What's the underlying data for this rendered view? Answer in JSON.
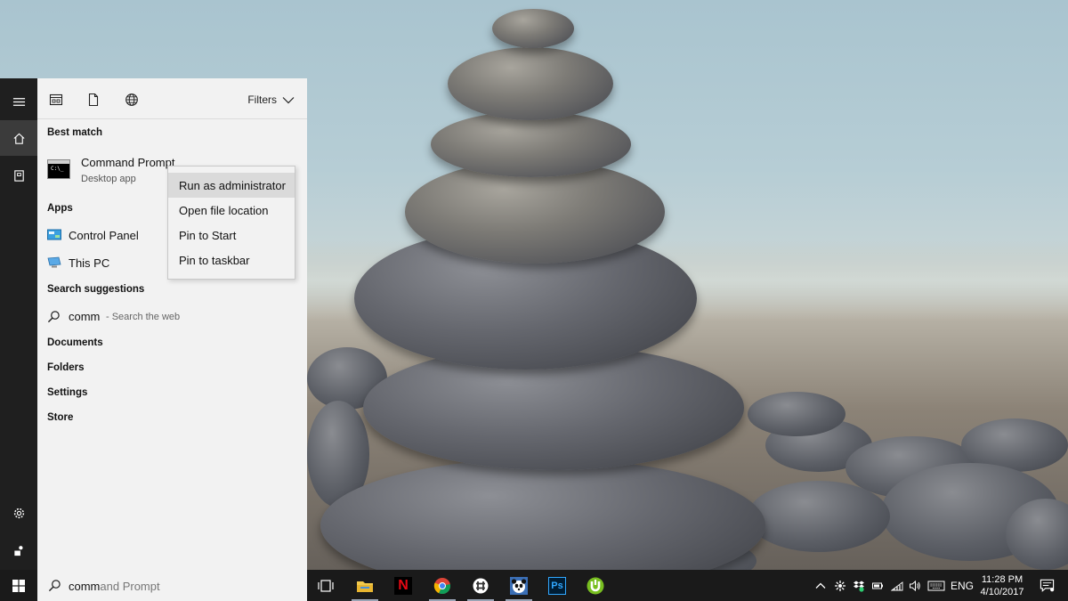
{
  "panel": {
    "filters_label": "Filters",
    "best_match": {
      "heading": "Best match",
      "title": "Command Prompt",
      "subtitle": "Desktop app"
    },
    "apps": {
      "heading": "Apps",
      "items": [
        {
          "label": "Control Panel",
          "icon": "control-panel-icon"
        },
        {
          "label": "This PC",
          "icon": "this-pc-icon"
        }
      ]
    },
    "suggestions": {
      "heading": "Search suggestions",
      "term": "comm",
      "hint": "- Search the web"
    },
    "categories": [
      "Documents",
      "Folders",
      "Settings",
      "Store"
    ]
  },
  "context_menu": {
    "items": [
      "Run as administrator",
      "Open file location",
      "Pin to Start",
      "Pin to taskbar"
    ],
    "highlighted_index": 0
  },
  "search": {
    "typed": "comm",
    "completion": "and Prompt"
  },
  "taskbar": {
    "apps": [
      {
        "name": "task-view-icon"
      },
      {
        "name": "file-explorer-icon"
      },
      {
        "name": "netflix-icon",
        "glyph": "N"
      },
      {
        "name": "chrome-icon"
      },
      {
        "name": "slack-icon"
      },
      {
        "name": "panda-icon"
      },
      {
        "name": "photoshop-icon",
        "glyph": "Ps"
      },
      {
        "name": "utorrent-icon"
      }
    ],
    "language": "ENG",
    "time": "11:28 PM",
    "date": "4/10/2017"
  },
  "colors": {
    "rail": "#1f1f1f",
    "panel": "#f2f2f2",
    "taskbar": "#1a1a1a",
    "highlight": "#dadada",
    "accent_blue": "#1e90ff"
  }
}
